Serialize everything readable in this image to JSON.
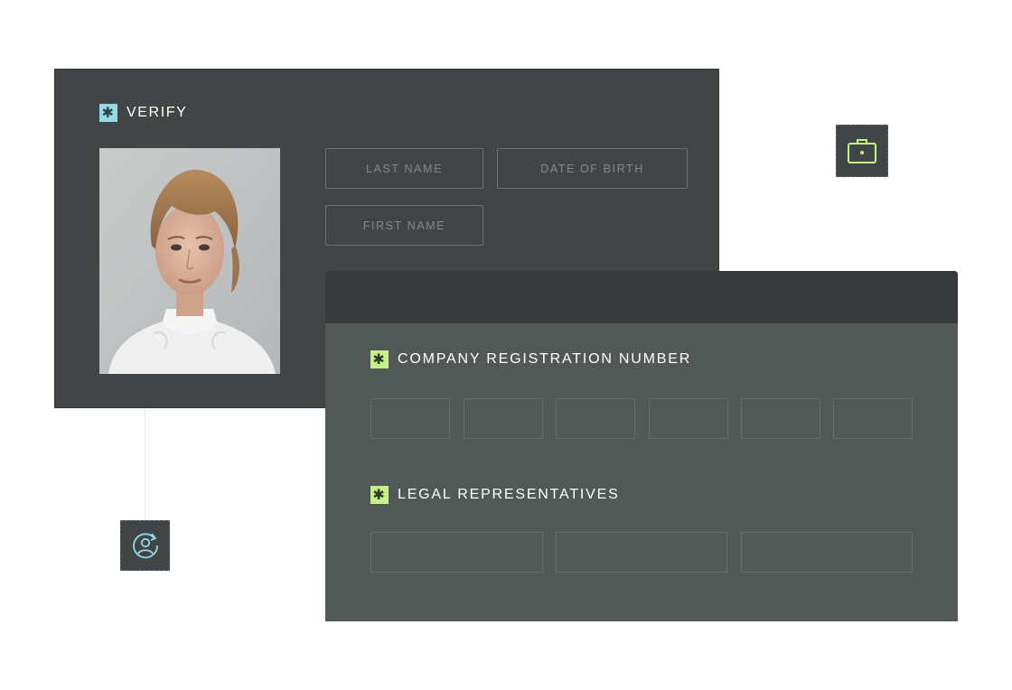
{
  "verify": {
    "heading": "VERIFY",
    "fields": {
      "last_name_placeholder": "LAST NAME",
      "date_of_birth_placeholder": "DATE OF BIRTH",
      "first_name_placeholder": "FIRST NAME"
    }
  },
  "company": {
    "registration_heading": "COMPANY REGISTRATION NUMBER",
    "representatives_heading": "LEGAL REPRESENTATIVES",
    "registration_boxes": [
      "",
      "",
      "",
      "",
      "",
      ""
    ],
    "representative_boxes": [
      "",
      "",
      ""
    ]
  },
  "icons": {
    "heading_marker": "asterisk-icon",
    "floating_right": "briefcase-icon",
    "floating_left": "user-refresh-icon"
  },
  "colors": {
    "panel": "#414545",
    "panel_secondary": "#515856",
    "teal_accent": "#92dbe6",
    "lime_accent": "#c6f08a"
  }
}
